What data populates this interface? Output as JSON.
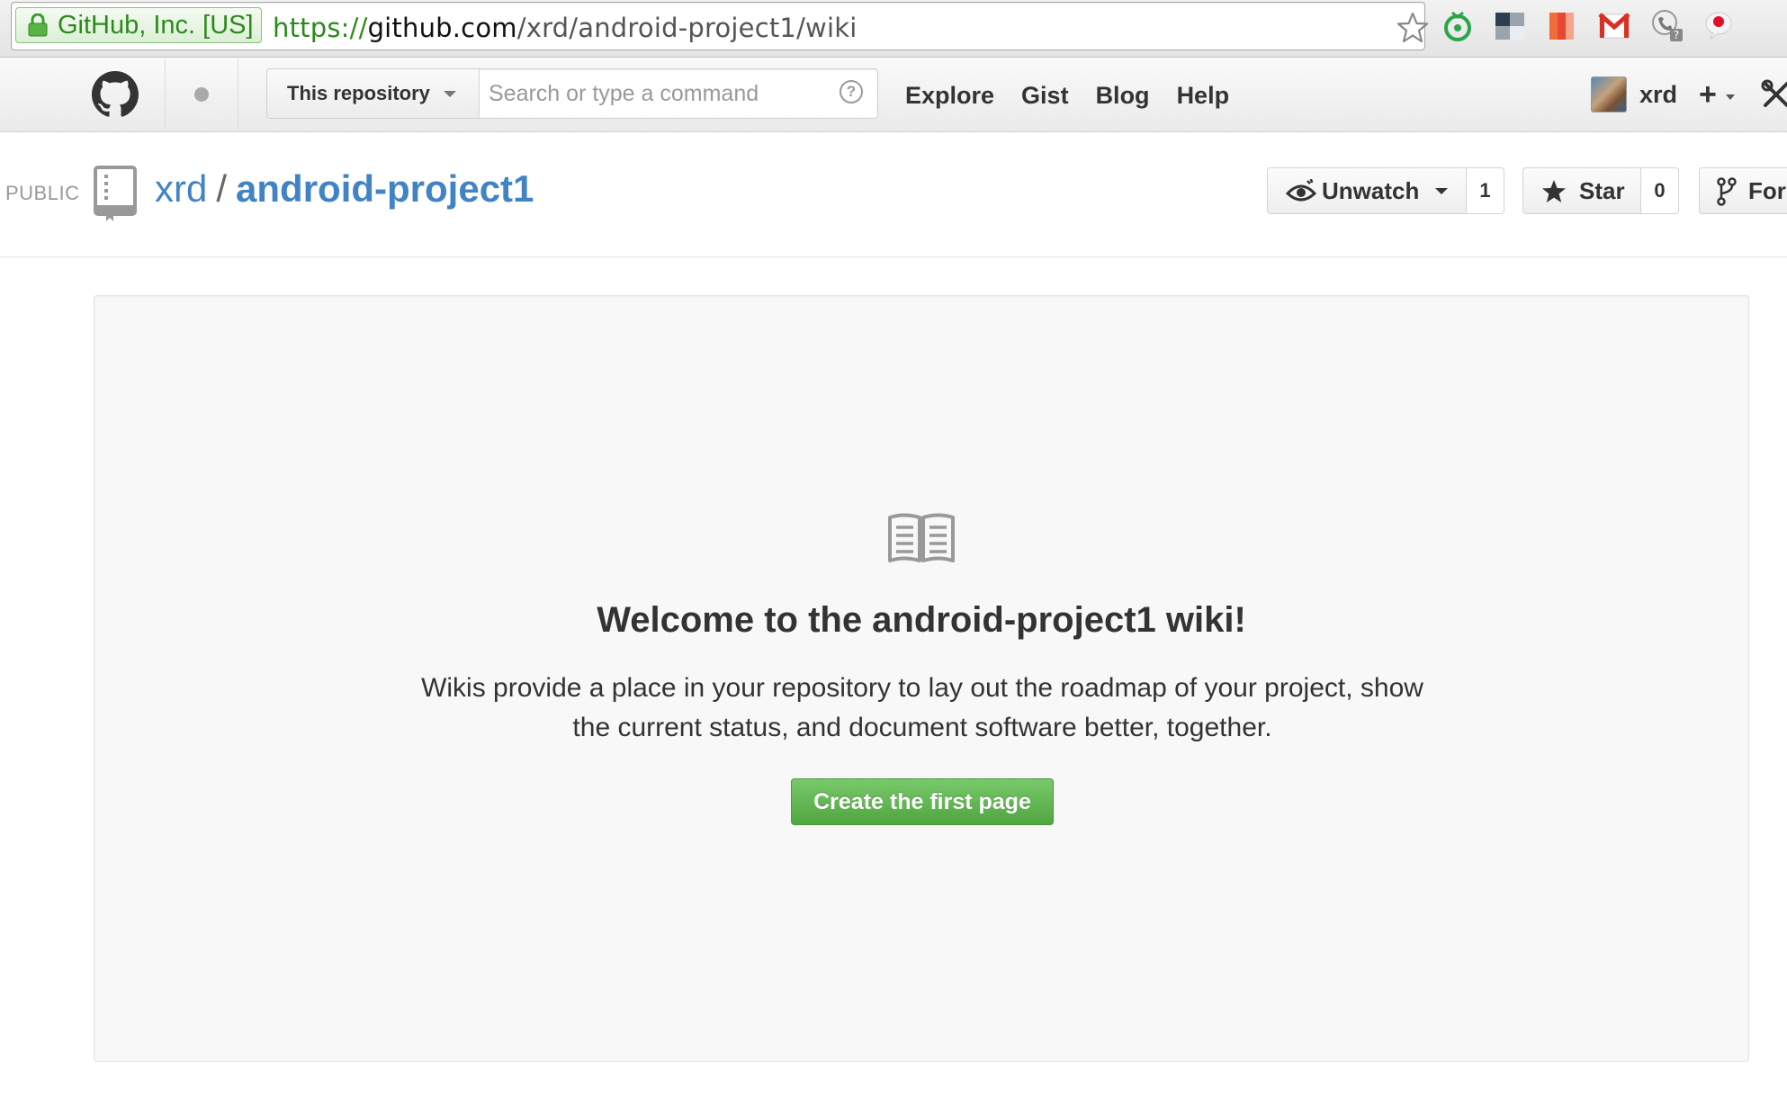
{
  "browser": {
    "ev_label": "GitHub, Inc. [US]",
    "url_scheme": "https://",
    "url_host": "github.com",
    "url_path": "/xrd/android-project1/wiki",
    "extensions": [
      "tomato-timer-icon",
      "window-tile-icon",
      "stripes-icon",
      "gmail-icon",
      "phone-help-icon",
      "red-balloon-icon"
    ]
  },
  "header": {
    "scope_label": "This repository",
    "search_placeholder": "Search or type a command",
    "help_symbol": "?",
    "nav": [
      "Explore",
      "Gist",
      "Blog",
      "Help"
    ],
    "username": "xrd",
    "plus_label": "+"
  },
  "repo": {
    "visibility": "PUBLIC",
    "owner": "xrd",
    "separator": "/",
    "name": "android-project1",
    "unwatch_label": "Unwatch",
    "watch_count": "1",
    "star_label": "Star",
    "star_count": "0",
    "fork_label": "Fork"
  },
  "wiki": {
    "title": "Welcome to the android-project1 wiki!",
    "description": "Wikis provide a place in your repository to lay out the roadmap of your project, show the current status, and document software better, together.",
    "create_label": "Create the first page"
  },
  "colors": {
    "link": "#4183c4",
    "create_button": "#5fb54f",
    "ev_green": "#2c8a1d"
  }
}
